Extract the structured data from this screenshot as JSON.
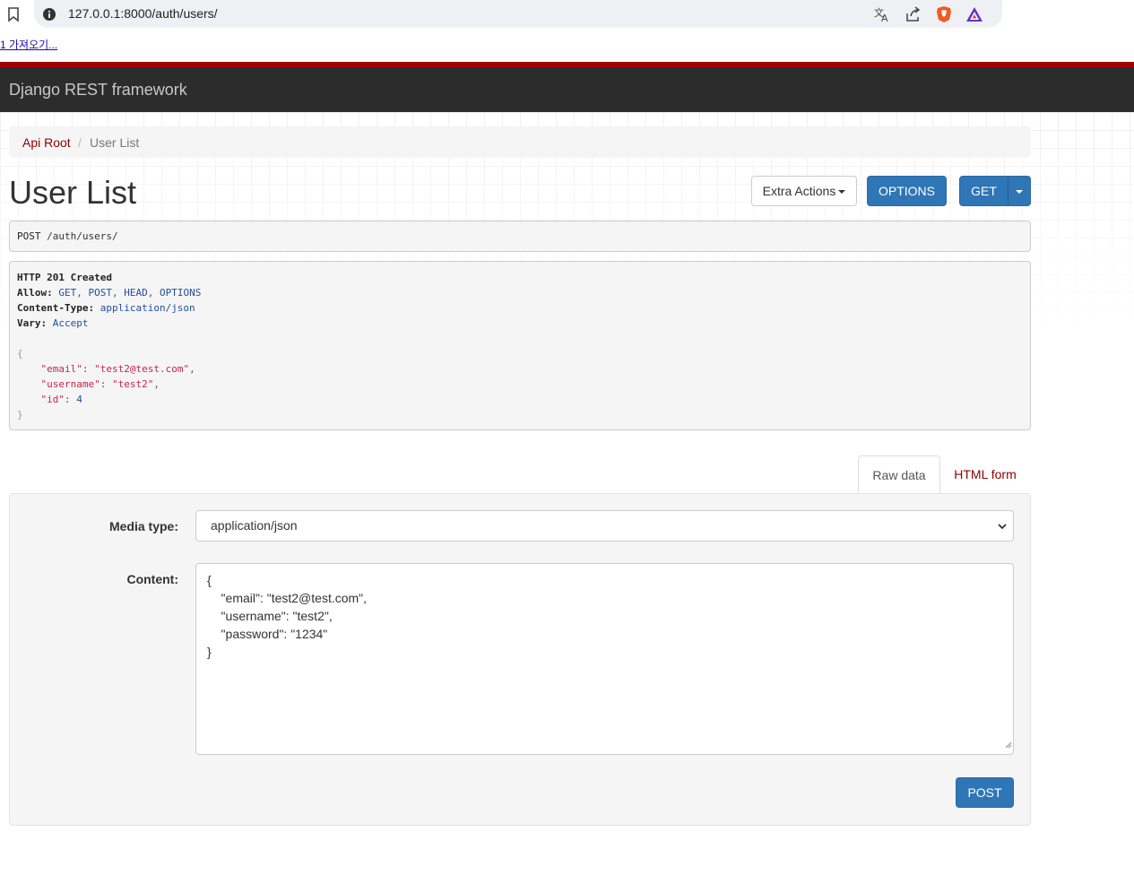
{
  "browser": {
    "url": "127.0.0.1:8000/auth/users/",
    "bookmark_text": "1 가져오기..."
  },
  "navbar": {
    "brand": "Django REST framework"
  },
  "breadcrumb": {
    "root": "Api Root",
    "separator": "/",
    "current": "User List"
  },
  "page": {
    "title": "User List"
  },
  "buttons": {
    "extra_actions": "Extra Actions",
    "options": "OPTIONS",
    "get": "GET",
    "post": "POST"
  },
  "request": {
    "method": "POST",
    "path": "/auth/users/"
  },
  "response": {
    "status": "HTTP 201 Created",
    "allow_key": "Allow:",
    "allow_methods": [
      "GET",
      "POST",
      "HEAD",
      "OPTIONS"
    ],
    "content_type_key": "Content-Type:",
    "content_type": "application/json",
    "vary_key": "Vary:",
    "vary": "Accept",
    "body_open": "{",
    "body_close": "}",
    "body": [
      {
        "key": "\"email\"",
        "value": "\"test2@test.com\"",
        "sep": ","
      },
      {
        "key": "\"username\"",
        "value": "\"test2\"",
        "sep": ","
      },
      {
        "key": "\"id\"",
        "value": "4",
        "sep": ""
      }
    ]
  },
  "tabs": {
    "raw": "Raw data",
    "html": "HTML form"
  },
  "form": {
    "media_label": "Media type:",
    "media_value": "application/json",
    "content_label": "Content:",
    "content_lines": [
      "{",
      "    \"email\": \"test2@test.com\",",
      "    \"username\": \"test2\",",
      "    \"password\": \"1234\"",
      "}"
    ]
  },
  "colors": {
    "navbar": "#2c2c2c",
    "accent_red": "#a30000",
    "primary_button": "#2f76b6",
    "link": "#8b0000"
  }
}
